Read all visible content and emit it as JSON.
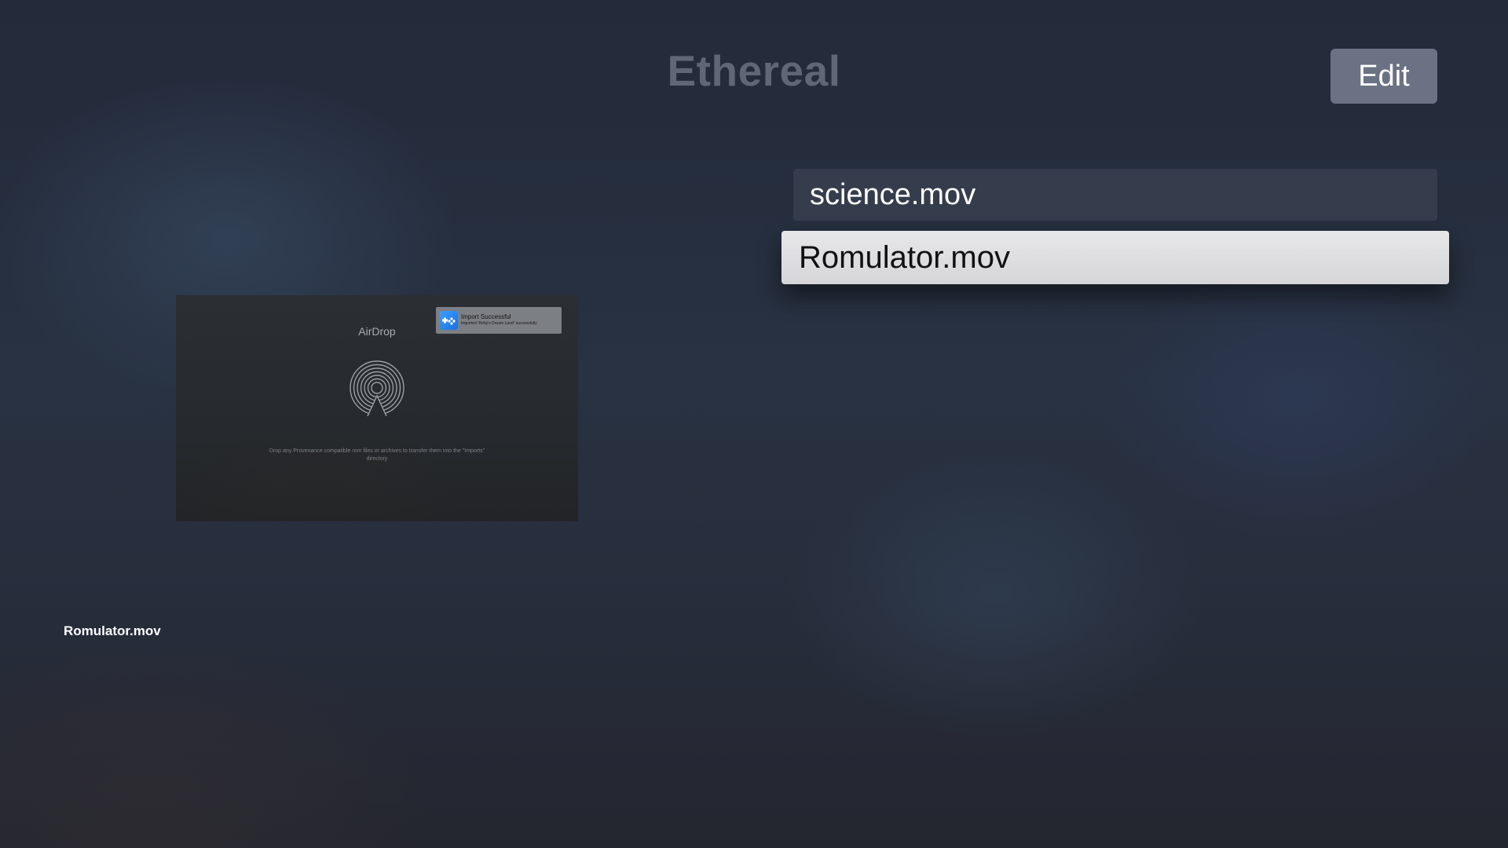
{
  "header": {
    "title": "Ethereal",
    "edit_label": "Edit"
  },
  "files": [
    {
      "name": "science.mov",
      "focused": false
    },
    {
      "name": "Romulator.mov",
      "focused": true
    }
  ],
  "preview": {
    "screen_title": "AirDrop",
    "description": "Drop any Provenance compatible rom files or archives to transfer them into the \"Imports\" directory",
    "toast": {
      "title": "Import Successful",
      "body": "Imported \"Kirby's Dream Land\" successfully"
    },
    "caption": "Romulator.mov"
  },
  "icons": {
    "airdrop": "airdrop-icon",
    "toast_app": "gamepad-icon"
  },
  "colors": {
    "focused_row": "#d9d9dc",
    "unfocused_row": "#384050",
    "edit_button": "#6b7283",
    "title": "#5f6777"
  }
}
